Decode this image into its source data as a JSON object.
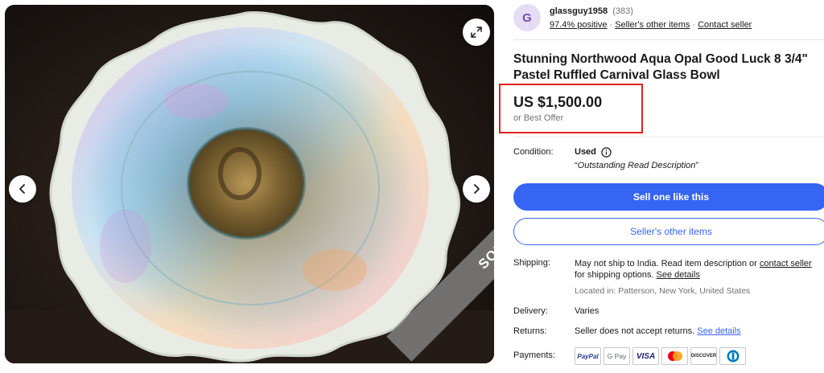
{
  "gallery": {
    "sold_label": "SOLD",
    "prev_icon": "chevron-left-icon",
    "next_icon": "chevron-right-icon",
    "expand_icon": "expand-icon"
  },
  "seller": {
    "avatar_letter": "G",
    "name": "glassguy1958",
    "feedback_count": "(383)",
    "positive": "97.4% positive",
    "other_items_link": "Seller's other items",
    "contact_link": "Contact seller",
    "separator": "·"
  },
  "item": {
    "title": "Stunning Northwood Aqua Opal Good Luck 8 3/4\" Pastel Ruffled Carnival Glass Bowl",
    "price": "US $1,500.00",
    "best_offer": "or Best Offer"
  },
  "condition": {
    "label": "Condition:",
    "value": "Used",
    "desc_open": "“",
    "desc": "Outstanding Read Description",
    "desc_close": "”"
  },
  "actions": {
    "primary_label": "Sell one like this",
    "secondary_label": "Seller's other items"
  },
  "shipping": {
    "label": "Shipping:",
    "text_1": "May not ship to India. Read item description or ",
    "contact_link": "contact seller",
    "text_2": " for shipping options. ",
    "details_link": "See details",
    "located": "Located in: Patterson, New York, United States"
  },
  "delivery": {
    "label": "Delivery:",
    "value": "Varies"
  },
  "returns": {
    "label": "Returns:",
    "text": "Seller does not accept returns. ",
    "details_link": "See details"
  },
  "payments": {
    "label": "Payments:",
    "methods": [
      "PayPal",
      "G Pay",
      "VISA",
      "Mastercard",
      "DISCOVER",
      "Diners Club"
    ]
  },
  "colors": {
    "accent": "#3665f3",
    "highlight_box": "#e02020",
    "avatar_bg": "#e7dcf5"
  }
}
